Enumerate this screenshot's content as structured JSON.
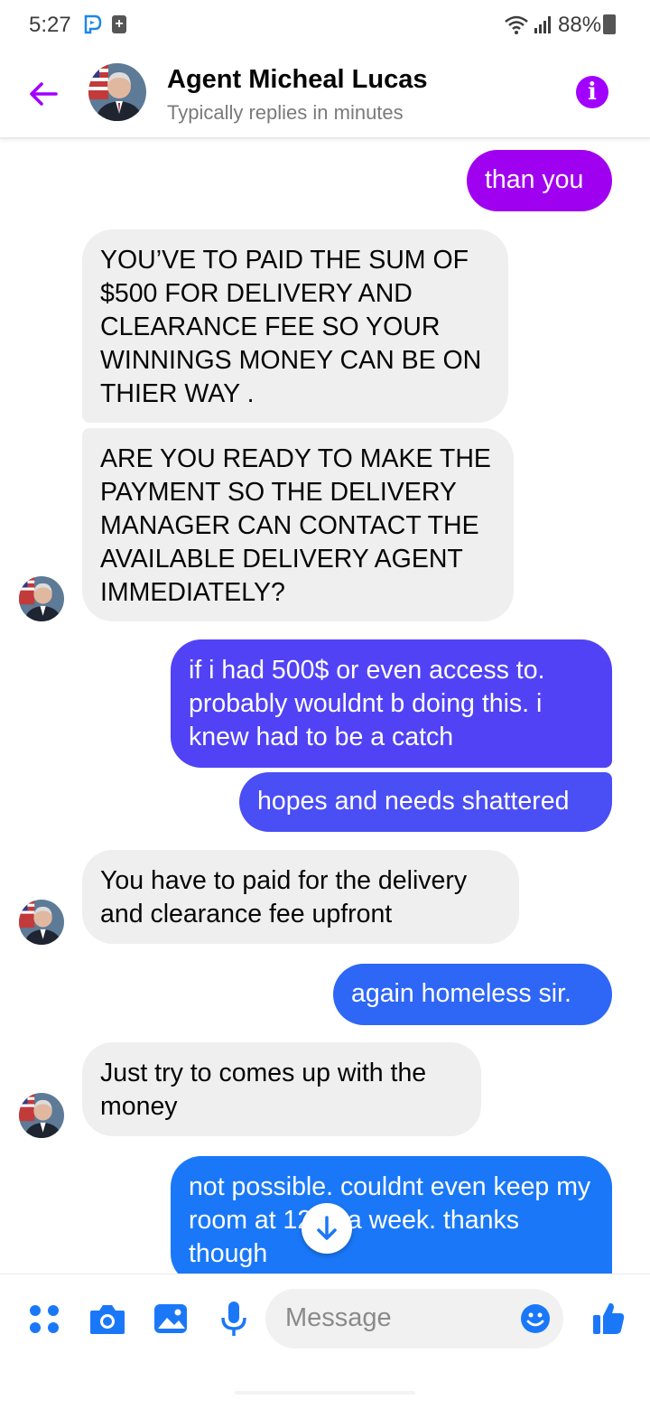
{
  "status_bar": {
    "time": "5:27",
    "battery": "88%"
  },
  "header": {
    "name": "Agent Micheal Lucas",
    "subtitle": "Typically replies in minutes",
    "accent_color": "#a100ff"
  },
  "messages": [
    {
      "sender": "me",
      "text": "than you",
      "color": "#a000f0"
    },
    {
      "sender": "agent",
      "text": "YOU’VE TO PAID THE SUM OF $500 FOR DELIVERY AND CLEARANCE FEE SO YOUR WINNINGS MONEY CAN BE ON THIER WAY ."
    },
    {
      "sender": "agent",
      "text": "ARE YOU READY TO MAKE THE PAYMENT SO THE DELIVERY MANAGER CAN CONTACT THE AVAILABLE DELIVERY AGENT IMMEDIATELY?"
    },
    {
      "sender": "me",
      "text": "if i had 500$ or even access to. probably wouldnt b doing this. i knew had to be a catch",
      "color": "#5142f5"
    },
    {
      "sender": "me",
      "text": "hopes and needs shattered",
      "color": "#4a4ef5"
    },
    {
      "sender": "agent",
      "text": "You have to paid for the delivery and clearance fee upfront"
    },
    {
      "sender": "me",
      "text": "again homeless sir.",
      "color": "#2e66f5"
    },
    {
      "sender": "agent",
      "text": "Just try to comes up with the money"
    },
    {
      "sender": "me",
      "text": "not possible. couldnt even keep my room at 125$ a week. thanks though",
      "color": "#1a78f8"
    }
  ],
  "composer": {
    "placeholder": "Message",
    "icon_color": "#1a78f8"
  },
  "icons": [
    "back-arrow-icon",
    "info-icon",
    "menu-dots-icon",
    "camera-icon",
    "gallery-icon",
    "microphone-icon",
    "emoji-icon",
    "thumbs-up-icon",
    "scroll-down-icon"
  ]
}
